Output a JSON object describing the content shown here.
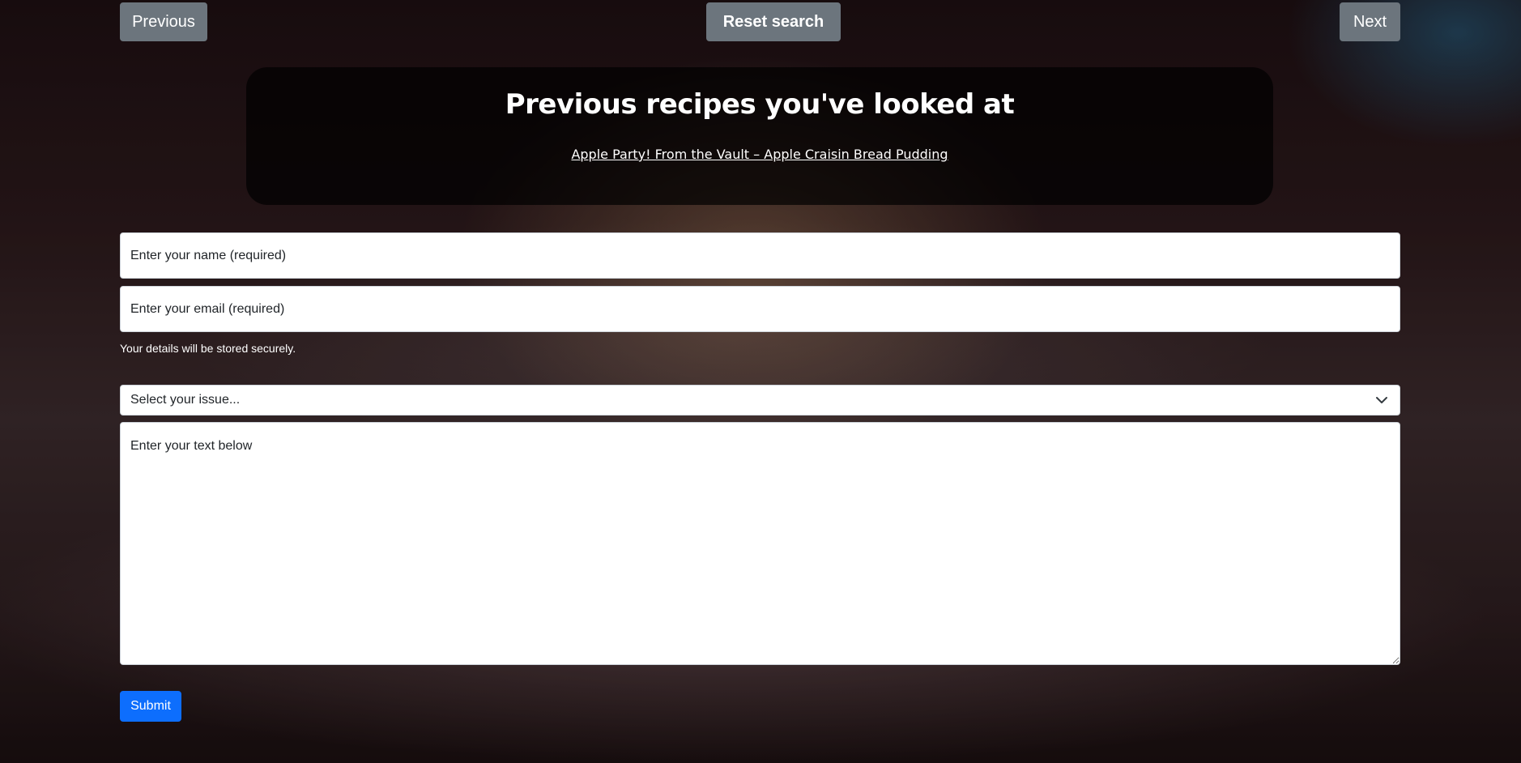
{
  "nav": {
    "previous_label": "Previous",
    "reset_label": "Reset search",
    "next_label": "Next"
  },
  "history": {
    "title": "Previous recipes you've looked at",
    "items": [
      {
        "label": "Apple Party! From the Vault – Apple Craisin Bread Pudding"
      }
    ]
  },
  "form": {
    "name_placeholder": "Enter your name (required)",
    "email_placeholder": "Enter your email (required)",
    "help_text": "Your details will be stored securely.",
    "issue_select_value": "Select your issue...",
    "text_placeholder": "Enter your text below",
    "submit_label": "Submit"
  },
  "icons": {
    "select_arrow": "chevron-down-icon"
  },
  "colors": {
    "secondary_button": "#6c757d",
    "primary_button": "#0d6efd",
    "panel_background": "rgba(0,0,0,0.70)"
  }
}
